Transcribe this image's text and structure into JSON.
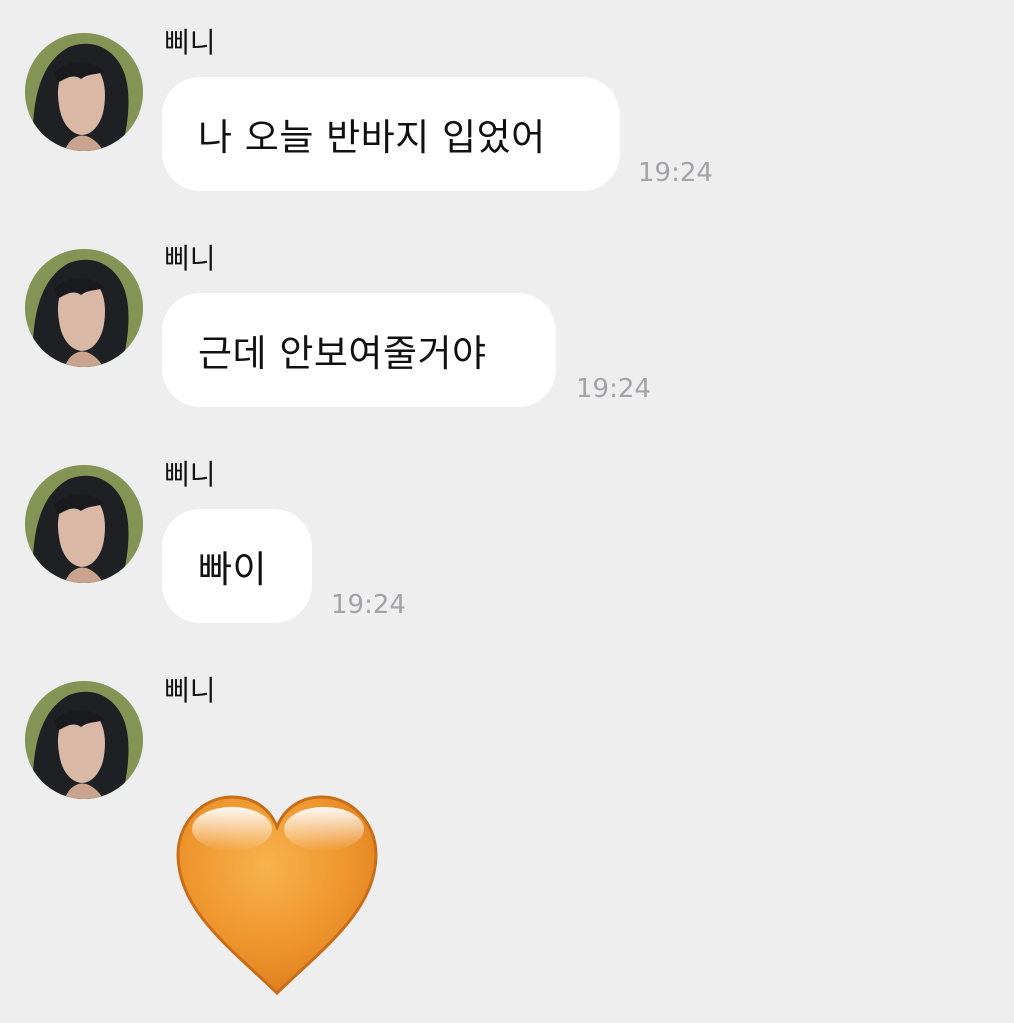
{
  "messages": [
    {
      "sender": "삐니",
      "text": "나 오늘 반바지 입었어",
      "time": "19:24"
    },
    {
      "sender": "삐니",
      "text": "근데 안보여줄거야",
      "time": "19:24"
    },
    {
      "sender": "삐니",
      "text": "빠이",
      "time": "19:24"
    },
    {
      "sender": "삐니",
      "emoji": "orange-heart",
      "time": ""
    }
  ],
  "colors": {
    "background": "#eeeeef",
    "bubble": "#ffffff",
    "time_text": "#a3a3a6",
    "heart": "#f0982f"
  }
}
